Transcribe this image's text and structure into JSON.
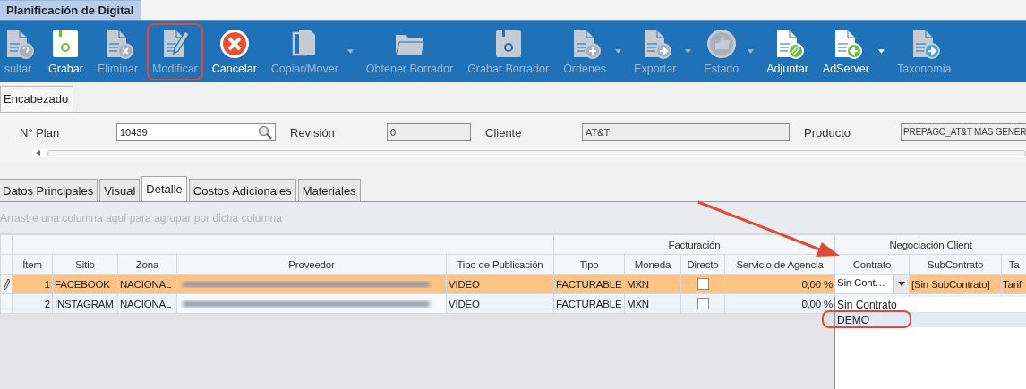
{
  "window": {
    "title": "Planificación de Digital"
  },
  "toolbar": [
    {
      "label": "sultar",
      "disabled": true,
      "dropdown": false,
      "highlighted": false
    },
    {
      "label": "Grabar",
      "disabled": false,
      "dropdown": false,
      "highlighted": false
    },
    {
      "label": "Eliminar",
      "disabled": true,
      "dropdown": false,
      "highlighted": false
    },
    {
      "label": "Modificar",
      "disabled": true,
      "dropdown": false,
      "highlighted": true
    },
    {
      "label": "Cancelar",
      "disabled": false,
      "dropdown": false,
      "highlighted": false
    },
    {
      "label": "Copiar/Mover",
      "disabled": true,
      "dropdown": true,
      "highlighted": false
    },
    {
      "label": "Obtener Borrador",
      "disabled": true,
      "dropdown": false,
      "highlighted": false
    },
    {
      "label": "Grabar Borrador",
      "disabled": true,
      "dropdown": false,
      "highlighted": false
    },
    {
      "label": "Órdenes",
      "disabled": true,
      "dropdown": true,
      "highlighted": false
    },
    {
      "label": "Exportar",
      "disabled": true,
      "dropdown": true,
      "highlighted": false
    },
    {
      "label": "Estado",
      "disabled": true,
      "dropdown": true,
      "highlighted": false
    },
    {
      "label": "Adjuntar",
      "disabled": false,
      "dropdown": false,
      "highlighted": false
    },
    {
      "label": "AdServer",
      "disabled": false,
      "dropdown": true,
      "highlighted": false
    },
    {
      "label": "Taxonomia",
      "disabled": true,
      "dropdown": false,
      "highlighted": false
    }
  ],
  "header_tab": {
    "label": "Encabezado"
  },
  "fields": [
    {
      "label": "N° Plan",
      "value": "10439",
      "kind": "search"
    },
    {
      "label": "Revisión",
      "value": "0",
      "kind": "readonly"
    },
    {
      "label": "Cliente",
      "value": "AT&T",
      "kind": "readonly"
    },
    {
      "label": "Producto",
      "value": "PREPAGO_AT&T MAS GENER",
      "kind": "readonly"
    }
  ],
  "tabs": [
    {
      "label": "Datos Principales",
      "selected": false
    },
    {
      "label": "Visual",
      "selected": false
    },
    {
      "label": "Detalle",
      "selected": true
    },
    {
      "label": "Costos Adicionales",
      "selected": false
    },
    {
      "label": "Materiales",
      "selected": false
    }
  ],
  "grid": {
    "group_panel_hint": "Arrastre una columna aquí para agrupar por dicha columna",
    "column_groups": [
      {
        "columns": [
          "Ítem",
          "Sitio",
          "Zona",
          "Proveedor",
          "Tipo de Publicación"
        ]
      },
      {
        "label": "Facturación",
        "columns": [
          "Tipo",
          "Moneda",
          "Directo",
          "Servicio de Agencia"
        ]
      },
      {
        "label": "Negociación Client",
        "columns": [
          "Contrato",
          "SubContrato",
          "Ta"
        ]
      }
    ],
    "rows": [
      {
        "selected": true,
        "editing": true,
        "item": "1",
        "sitio": "FACEBOOK",
        "zona": "NACIONAL",
        "tipo_publicacion": "VIDEO",
        "tipo": "FACTURABLE",
        "moneda": "MXN",
        "directo_checked": false,
        "servicio": "0,00 %",
        "contrato": "Sin Cont…",
        "subcontrato": "[Sin SubContrato]",
        "column_13": "Tarif"
      },
      {
        "selected": false,
        "editing": false,
        "item": "2",
        "sitio": "INSTAGRAM",
        "zona": "NACIONAL",
        "tipo_publicacion": "VIDEO",
        "tipo": "FACTURABLE",
        "moneda": "MXN",
        "directo_checked": false,
        "servicio": "0,00 %"
      }
    ],
    "dropdown": {
      "open": true,
      "options": [
        {
          "label": "Sin Contrato",
          "selected": false,
          "highlighted": false
        },
        {
          "label": "DEMO",
          "selected": true,
          "highlighted": true
        }
      ]
    }
  },
  "annotations": {
    "arrow": true
  }
}
